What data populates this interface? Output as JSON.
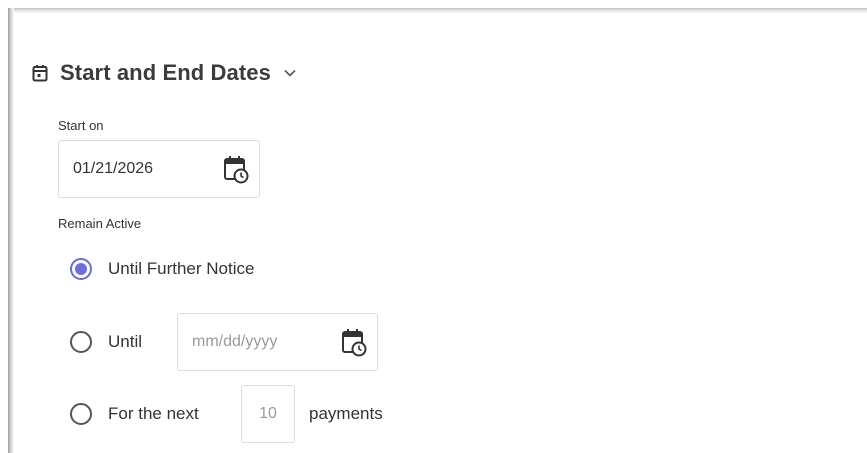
{
  "section": {
    "title": "Start and End Dates",
    "icon": "calendar-icon",
    "chevron_icon": "chevron-down-icon"
  },
  "start": {
    "label": "Start on",
    "value": "01/21/2026",
    "icon": "calendar-clock-icon"
  },
  "remain_active": {
    "label": "Remain Active",
    "selected": "until_further_notice",
    "options": {
      "until_further_notice": {
        "label": "Until Further Notice"
      },
      "until": {
        "label": "Until",
        "placeholder": "mm/dd/yyyy",
        "icon": "calendar-clock-icon"
      },
      "for_next": {
        "label": "For the next",
        "value": "10",
        "suffix": "payments"
      }
    }
  },
  "colors": {
    "accent": "#6e6ee0",
    "text": "#333333",
    "placeholder": "#9a9a9a",
    "border": "#dcdcdc"
  }
}
